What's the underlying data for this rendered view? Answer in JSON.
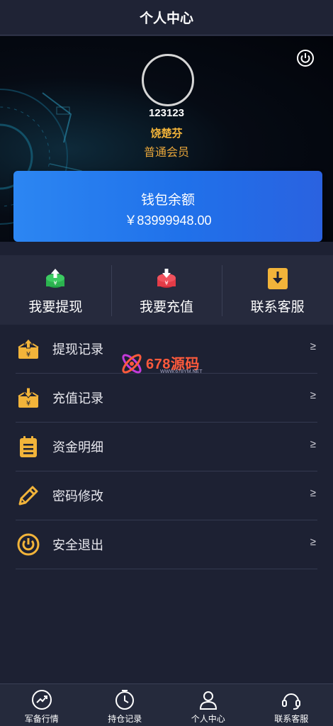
{
  "header": {
    "title": "个人中心"
  },
  "profile": {
    "user_id": "123123",
    "name": "饶楚芬",
    "level": "普通会员"
  },
  "wallet": {
    "label": "钱包余额",
    "balance": "￥83999948.00"
  },
  "actions": [
    {
      "label": "我要提现",
      "icon": "withdraw-icon",
      "color": "#2bb34f"
    },
    {
      "label": "我要充值",
      "icon": "recharge-icon",
      "color": "#e33b47"
    },
    {
      "label": "联系客服",
      "icon": "download-box-icon",
      "color": "#f2b43a"
    }
  ],
  "menu": [
    {
      "label": "提现记录",
      "icon": "withdraw-record-icon",
      "arrow": "≥"
    },
    {
      "label": "充值记录",
      "icon": "recharge-record-icon",
      "arrow": "≥"
    },
    {
      "label": "资金明细",
      "icon": "clipboard-icon",
      "arrow": "≥"
    },
    {
      "label": "密码修改",
      "icon": "pencil-icon",
      "arrow": "≥"
    },
    {
      "label": "安全退出",
      "icon": "power-icon",
      "arrow": "≥"
    }
  ],
  "watermark": {
    "text": "678源码",
    "sub": "WWW.678YM.NET"
  },
  "tabbar": [
    {
      "label": "军备行情",
      "icon": "trend-icon"
    },
    {
      "label": "持仓记录",
      "icon": "clock-icon"
    },
    {
      "label": "个人中心",
      "icon": "user-icon"
    },
    {
      "label": "联系客服",
      "icon": "headset-icon"
    }
  ],
  "colors": {
    "accent_gold": "#f2b43a",
    "wallet_blue": "#2071ea",
    "background": "#1d2133"
  }
}
